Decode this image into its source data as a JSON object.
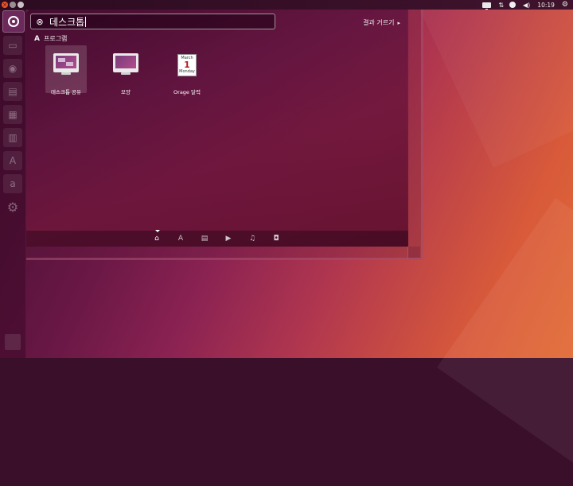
{
  "search": {
    "query": "데스크톱"
  },
  "filter": {
    "label": "결과 거르기"
  },
  "category": {
    "label": "프로그램"
  },
  "results": [
    {
      "label": "데스크톱 공유"
    },
    {
      "label": "모양"
    },
    {
      "label": "Orage 달력"
    }
  ],
  "calendar_icon": {
    "month": "March",
    "day": "1",
    "weekday": "Monday"
  },
  "panel": {
    "clock": "10:19"
  },
  "launcher": {
    "items": [
      "ubuntu-home",
      "files",
      "firefox",
      "writer",
      "calc",
      "impress",
      "software-center",
      "amazon",
      "settings"
    ]
  },
  "scope_bar": {
    "lenses": [
      "home",
      "applications",
      "files",
      "video",
      "music",
      "photos"
    ],
    "active": "home"
  }
}
